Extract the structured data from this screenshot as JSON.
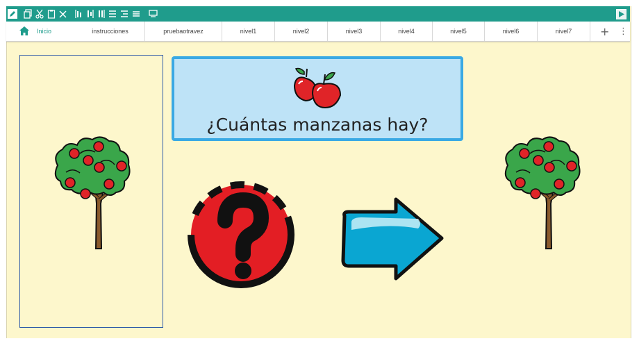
{
  "toolbar": {
    "icons": [
      "edit-icon",
      "copy-icon",
      "cut-icon",
      "paste-icon",
      "delete-icon",
      "align-left-icon",
      "align-center-icon",
      "align-right-icon",
      "distribute-vertical-icon",
      "distribute-horizontal-icon",
      "distribute-menu-icon",
      "presentation-icon",
      "play-icon"
    ],
    "color": "#1f9c8c"
  },
  "tabs": {
    "items": [
      {
        "label": "Inicio"
      },
      {
        "label": "instrucciones"
      },
      {
        "label": "pruebaotravez"
      },
      {
        "label": "nivel1"
      },
      {
        "label": "nivel2"
      },
      {
        "label": "nivel3"
      },
      {
        "label": "nivel4"
      },
      {
        "label": "nivel5"
      },
      {
        "label": "nivel6"
      },
      {
        "label": "nivel7"
      }
    ],
    "add_label": "+",
    "more_label": "⋮"
  },
  "board": {
    "question_text": "¿Cuántas manzanas hay?",
    "question_icon": "apples-icon",
    "symbols": [
      "apple-tree-icon",
      "question-mark-icon",
      "arrow-right-icon",
      "apple-tree-icon"
    ],
    "background": "#fdf7cc",
    "question_bg": "#bee3f7",
    "question_border": "#3aa9e4"
  }
}
